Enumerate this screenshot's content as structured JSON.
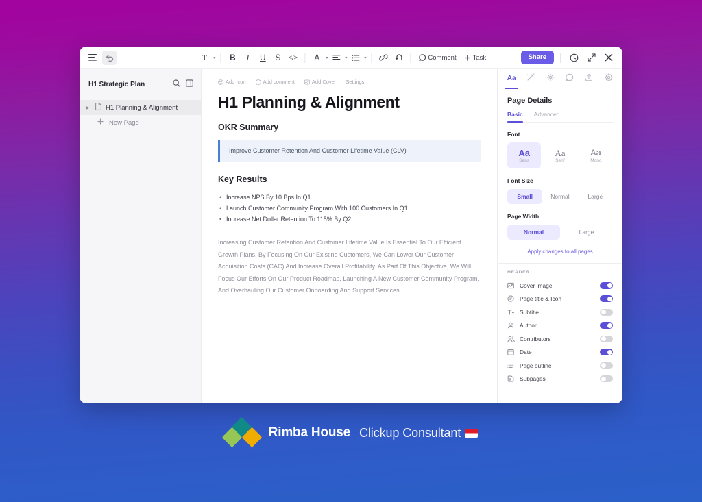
{
  "background": {
    "top_color": "#a3039f",
    "bottom_color": "#2b60c9"
  },
  "toolbar": {
    "menu_icon": "hamburger-menu-icon",
    "undo_icon": "undo-arrow-icon",
    "text_style_label": "T",
    "bold_label": "B",
    "italic_label": "I",
    "underline_label": "U",
    "strikethrough_label": "S",
    "code_label": "</>",
    "text_color_label": "A",
    "align_icon": "align-left-icon",
    "list_icon": "bullet-list-icon",
    "link_icon": "link-icon",
    "revert_icon": "undo-history-icon",
    "comment_label": "Comment",
    "task_label": "Task",
    "more_label": "···",
    "share_label": "Share",
    "history_icon": "clock-history-icon",
    "collapse_icon": "collapse-arrows-icon",
    "close_icon": "close-x-icon"
  },
  "sidebar": {
    "title": "H1 Strategic Plan",
    "search_icon": "search-icon",
    "panel_icon": "toggle-panel-icon",
    "items": [
      {
        "label": "H1 Planning & Alignment",
        "icon": "document-icon",
        "active": true
      },
      {
        "label": "New Page",
        "icon": "plus-icon",
        "active": false
      }
    ]
  },
  "document": {
    "actions": [
      {
        "label": "Add Icon",
        "icon": "emoji-icon"
      },
      {
        "label": "Add comment",
        "icon": "comment-icon"
      },
      {
        "label": "Add Cover",
        "icon": "image-icon"
      },
      {
        "label": "Settings",
        "icon": ""
      }
    ],
    "title": "H1 Planning & Alignment",
    "okr_heading": "OKR Summary",
    "okr_callout": "Improve Customer Retention And Customer Lifetime Value (CLV)",
    "key_results_heading": "Key Results",
    "key_results": [
      "Increase NPS By 10 Bps In Q1",
      "Launch Customer Community Program With 100 Customers In Q1",
      "Increase Net Dollar Retention To 115% By Q2"
    ],
    "paragraph": "Increasing Customer Retention And Customer Lifetime Value Is Essential To Our Efficient Growth Plans. By Focusing On Our Existing Customers, We Can Lower Our Customer Acquisition Costs (CAC) And Increase Overall Profitability. As Part Of This Objective, We Will Focus Our Efforts On Our Product Roadmap, Launching A New Customer Community Program, And Overhauling Our Customer Onboarding And Support Services."
  },
  "right_panel": {
    "accent_color": "#5b4fd6",
    "tabs": [
      {
        "icon": "font-aa-icon",
        "label": "Aa",
        "active": true
      },
      {
        "icon": "magic-pen-icon",
        "label": "",
        "active": false
      },
      {
        "icon": "ai-sparkle-icon",
        "label": "",
        "active": false
      },
      {
        "icon": "comment-bubble-icon",
        "label": "",
        "active": false
      },
      {
        "icon": "share-upload-icon",
        "label": "",
        "active": false
      },
      {
        "icon": "gear-icon",
        "label": "",
        "active": false
      }
    ],
    "title": "Page Details",
    "subtabs": [
      {
        "label": "Basic",
        "active": true
      },
      {
        "label": "Advanced",
        "active": false
      }
    ],
    "font_label": "Font",
    "font_options": [
      {
        "glyph": "Aa",
        "name": "Sans",
        "selected": true
      },
      {
        "glyph": "Aa",
        "name": "Serif",
        "selected": false
      },
      {
        "glyph": "Aa",
        "name": "Mono",
        "selected": false
      }
    ],
    "font_size_label": "Font Size",
    "font_sizes": [
      {
        "label": "Small",
        "selected": true
      },
      {
        "label": "Normal",
        "selected": false
      },
      {
        "label": "Large",
        "selected": false
      }
    ],
    "page_width_label": "Page Width",
    "page_widths": [
      {
        "label": "Normal",
        "selected": true
      },
      {
        "label": "Large",
        "selected": false
      }
    ],
    "apply_link": "Apply changes to all pages",
    "header_section_label": "HEADER",
    "header_options": [
      {
        "label": "Cover image",
        "icon": "image-icon",
        "on": true
      },
      {
        "label": "Page title & Icon",
        "icon": "page-title-icon",
        "on": true
      },
      {
        "label": "Subtitle",
        "icon": "subtitle-icon",
        "on": false
      },
      {
        "label": "Author",
        "icon": "person-icon",
        "on": true
      },
      {
        "label": "Contributors",
        "icon": "people-icon",
        "on": false
      },
      {
        "label": "Date",
        "icon": "calendar-icon",
        "on": true
      },
      {
        "label": "Page outline",
        "icon": "outline-icon",
        "on": false
      },
      {
        "label": "Subpages",
        "icon": "subpages-icon",
        "on": false
      }
    ]
  },
  "brand": {
    "logo_icon": "rimba-house-diamond-logo",
    "logo_colors": {
      "teal": "#0f8a87",
      "green": "#96c756",
      "gold": "#f0ac00"
    },
    "name": "Rimba House",
    "subtitle": "Clickup Consultant",
    "flag_icon": "indonesia-flag-icon"
  }
}
